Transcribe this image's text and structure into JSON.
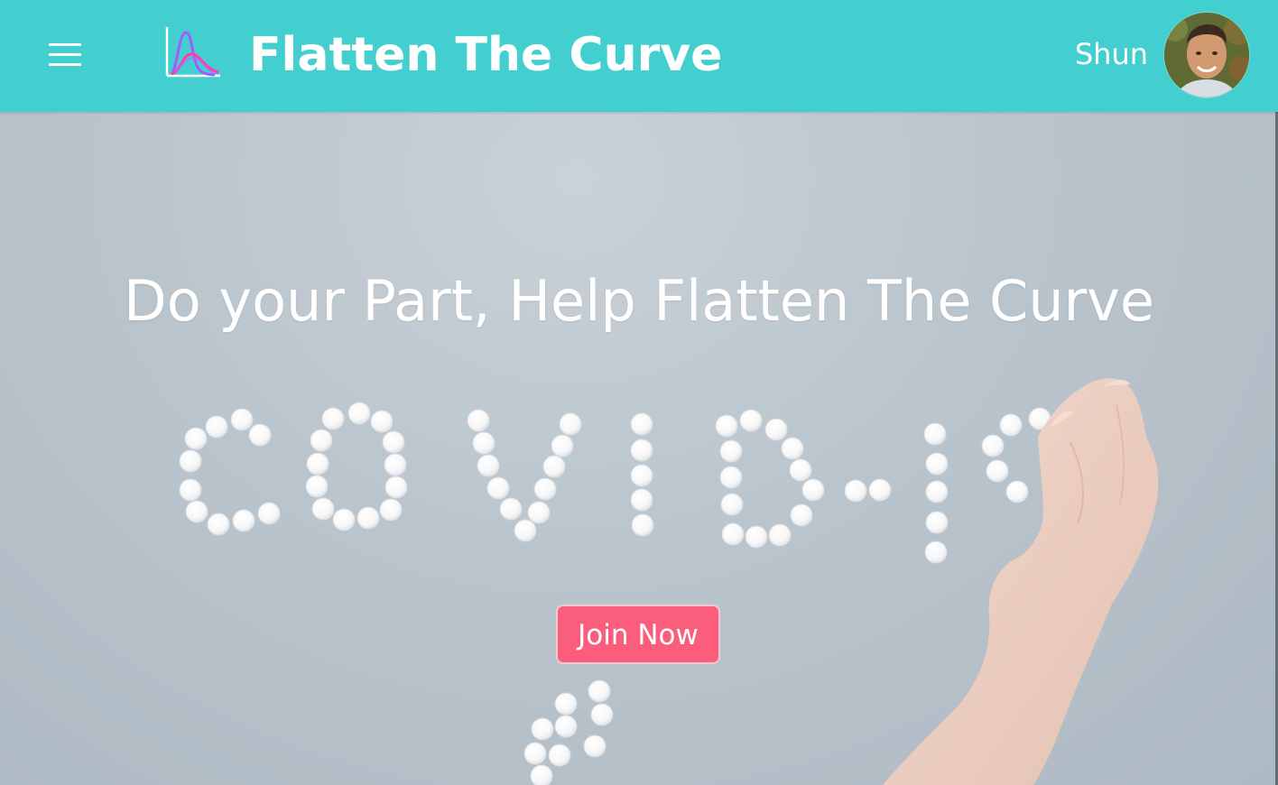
{
  "header": {
    "app_title": "Flatten The Curve",
    "user_name": "Shun",
    "icons": {
      "menu": "hamburger-menu-icon",
      "logo": "curve-chart-logo-icon",
      "avatar": "user-avatar"
    },
    "colors": {
      "background": "#43cfcf",
      "logo_curve_primary": "#a25cff",
      "logo_curve_secondary": "#ff3ea8"
    }
  },
  "hero": {
    "title": "Do your Part, Help Flatten The Curve",
    "cta_label": "Join Now",
    "colors": {
      "cta_background": "#fb5d7d",
      "text": "#ffffff"
    }
  }
}
